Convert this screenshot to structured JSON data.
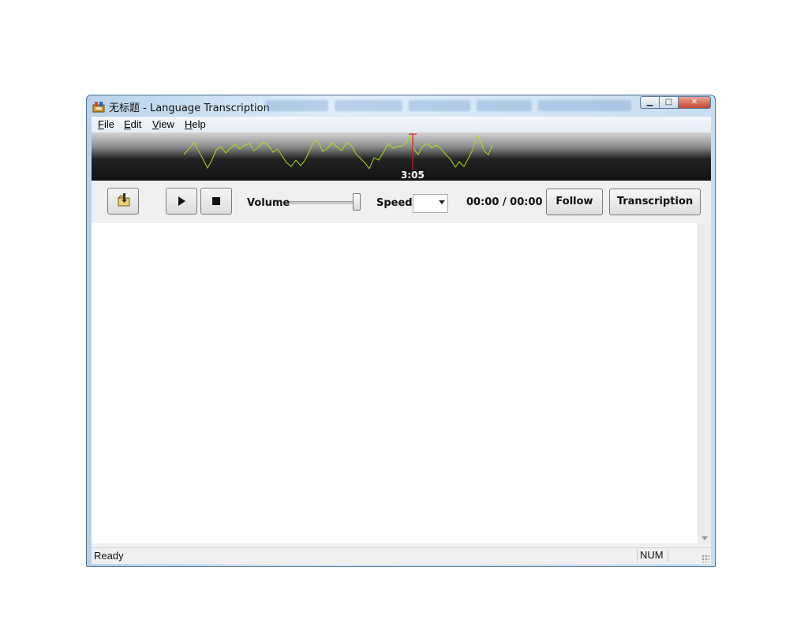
{
  "window": {
    "title": "无标题 - Language Transcription",
    "controls": [
      "minimize",
      "maximize",
      "close"
    ]
  },
  "menu": {
    "file": {
      "mnemonic": "F",
      "rest": "ile"
    },
    "edit": {
      "mnemonic": "E",
      "rest": "dit"
    },
    "view": {
      "mnemonic": "V",
      "rest": "iew"
    },
    "help": {
      "mnemonic": "H",
      "rest": "elp"
    }
  },
  "waveform": {
    "position_label": "3:05",
    "wave_color": "#a8e01c",
    "playhead_color": "#d02020"
  },
  "toolbar": {
    "open_icon": "open-folder-icon",
    "play_icon": "play-icon",
    "stop_icon": "stop-icon",
    "volume_label": "Volume",
    "volume_level": 1.0,
    "speed_label": "Speed",
    "speed_value": "",
    "time_readout": "00:00 / 00:00",
    "follow_label": "Follow",
    "transcription_label": "Transcription"
  },
  "editor": {
    "content": ""
  },
  "status": {
    "text": "Ready",
    "num": "NUM"
  }
}
